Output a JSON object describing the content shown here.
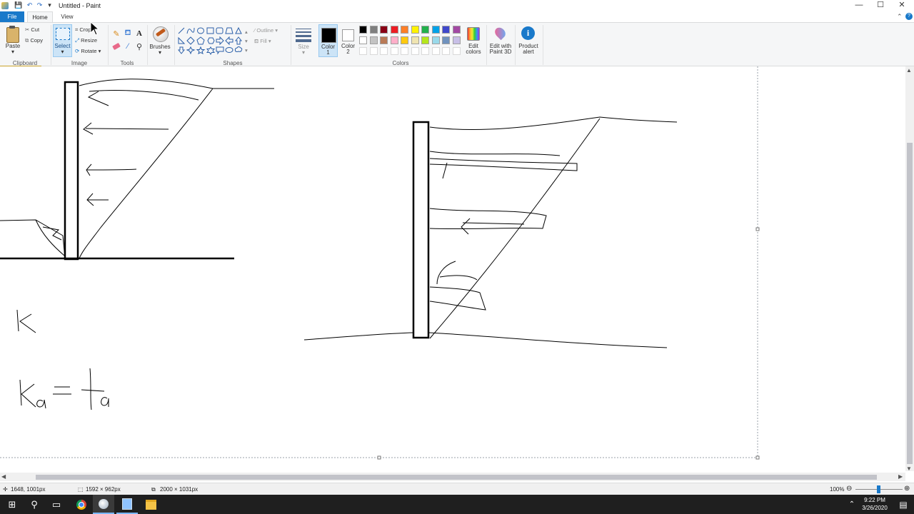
{
  "window": {
    "title": "Untitled - Paint"
  },
  "quick_access": {
    "save": "💾",
    "undo": "↶",
    "redo": "↷",
    "dropdown": "▾"
  },
  "window_controls": {
    "minimize": "—",
    "maximize": "☐",
    "close": "✕"
  },
  "tabs": {
    "file": "File",
    "home": "Home",
    "view": "View"
  },
  "ribbon": {
    "clipboard": {
      "label": "Clipboard",
      "paste": "Paste",
      "cut": "Cut",
      "copy": "Copy"
    },
    "image": {
      "label": "Image",
      "select": "Select",
      "crop": "Crop",
      "resize": "Resize",
      "rotate": "Rotate"
    },
    "tools": {
      "label": "Tools"
    },
    "brushes": {
      "label": "Brushes"
    },
    "shapes": {
      "label": "Shapes",
      "outline": "Outline",
      "fill": "Fill"
    },
    "size": {
      "label": "Size"
    },
    "color1": {
      "label": "Color",
      "num": "1"
    },
    "color2": {
      "label": "Color",
      "num": "2"
    },
    "colors": {
      "label": "Colors"
    },
    "edit_colors": {
      "line1": "Edit",
      "line2": "colors"
    },
    "paint3d": {
      "line1": "Edit with",
      "line2": "Paint 3D"
    },
    "product_alert": {
      "line1": "Product",
      "line2": "alert"
    },
    "palette_row1": [
      "#000000",
      "#7f7f7f",
      "#880015",
      "#ed1c24",
      "#ff7f27",
      "#fff200",
      "#22b14c",
      "#00a2e8",
      "#3f48cc",
      "#a349a4"
    ],
    "palette_row2": [
      "#ffffff",
      "#c3c3c3",
      "#b97a57",
      "#ffaec9",
      "#ffc90e",
      "#efe4b0",
      "#b5e61d",
      "#99d9ea",
      "#7092be",
      "#c8bfe7"
    ]
  },
  "status": {
    "cursor_pos": "1648, 1001px",
    "selection_size": "1592 × 962px",
    "image_size": "2000 × 1031px",
    "zoom": "100%"
  },
  "taskbar": {
    "time": "9:22 PM",
    "date": "3/26/2020"
  },
  "colors": {
    "accent": "#1979ca",
    "ribbon_bg": "#f5f6f7",
    "taskbar_bg": "#1f1f1f"
  }
}
